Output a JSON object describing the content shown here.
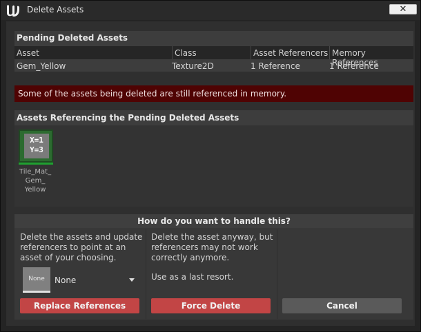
{
  "window": {
    "title": "Delete Assets",
    "close_label": "✕"
  },
  "pending": {
    "heading": "Pending Deleted Assets",
    "columns": [
      "Asset",
      "Class",
      "Asset Referencers",
      "Memory References"
    ],
    "rows": [
      {
        "asset": "Gem_Yellow",
        "class": "Texture2D",
        "asset_referencers": "1 Reference",
        "memory_references": "1 Reference"
      }
    ]
  },
  "warning": {
    "text": "Some of the assets being deleted are still referenced in memory."
  },
  "referencing": {
    "heading": "Assets Referencing the Pending Deleted Assets",
    "items": [
      {
        "thumb_line1": "X=1",
        "thumb_line2": "Y=3",
        "label_line1": "Tile_Mat_",
        "label_line2": "Gem_",
        "label_line3": "Yellow"
      }
    ]
  },
  "handle": {
    "heading": "How do you want to handle this?",
    "replace_description": "Delete the assets and update referencers to point at an asset of your choosing.",
    "force_description": "Delete the asset anyway, but referencers may not work correctly anymore.",
    "force_note": "Use as a last resort.",
    "picker": {
      "thumb_text": "None",
      "value": "None"
    },
    "replace_button": "Replace References",
    "force_button": "Force Delete",
    "cancel_button": "Cancel"
  },
  "colors": {
    "warning_bg": "#4f0303",
    "danger_button": "#c24545",
    "neutral_button": "#5a5a5a",
    "thumb_green": "#2c6b30"
  }
}
